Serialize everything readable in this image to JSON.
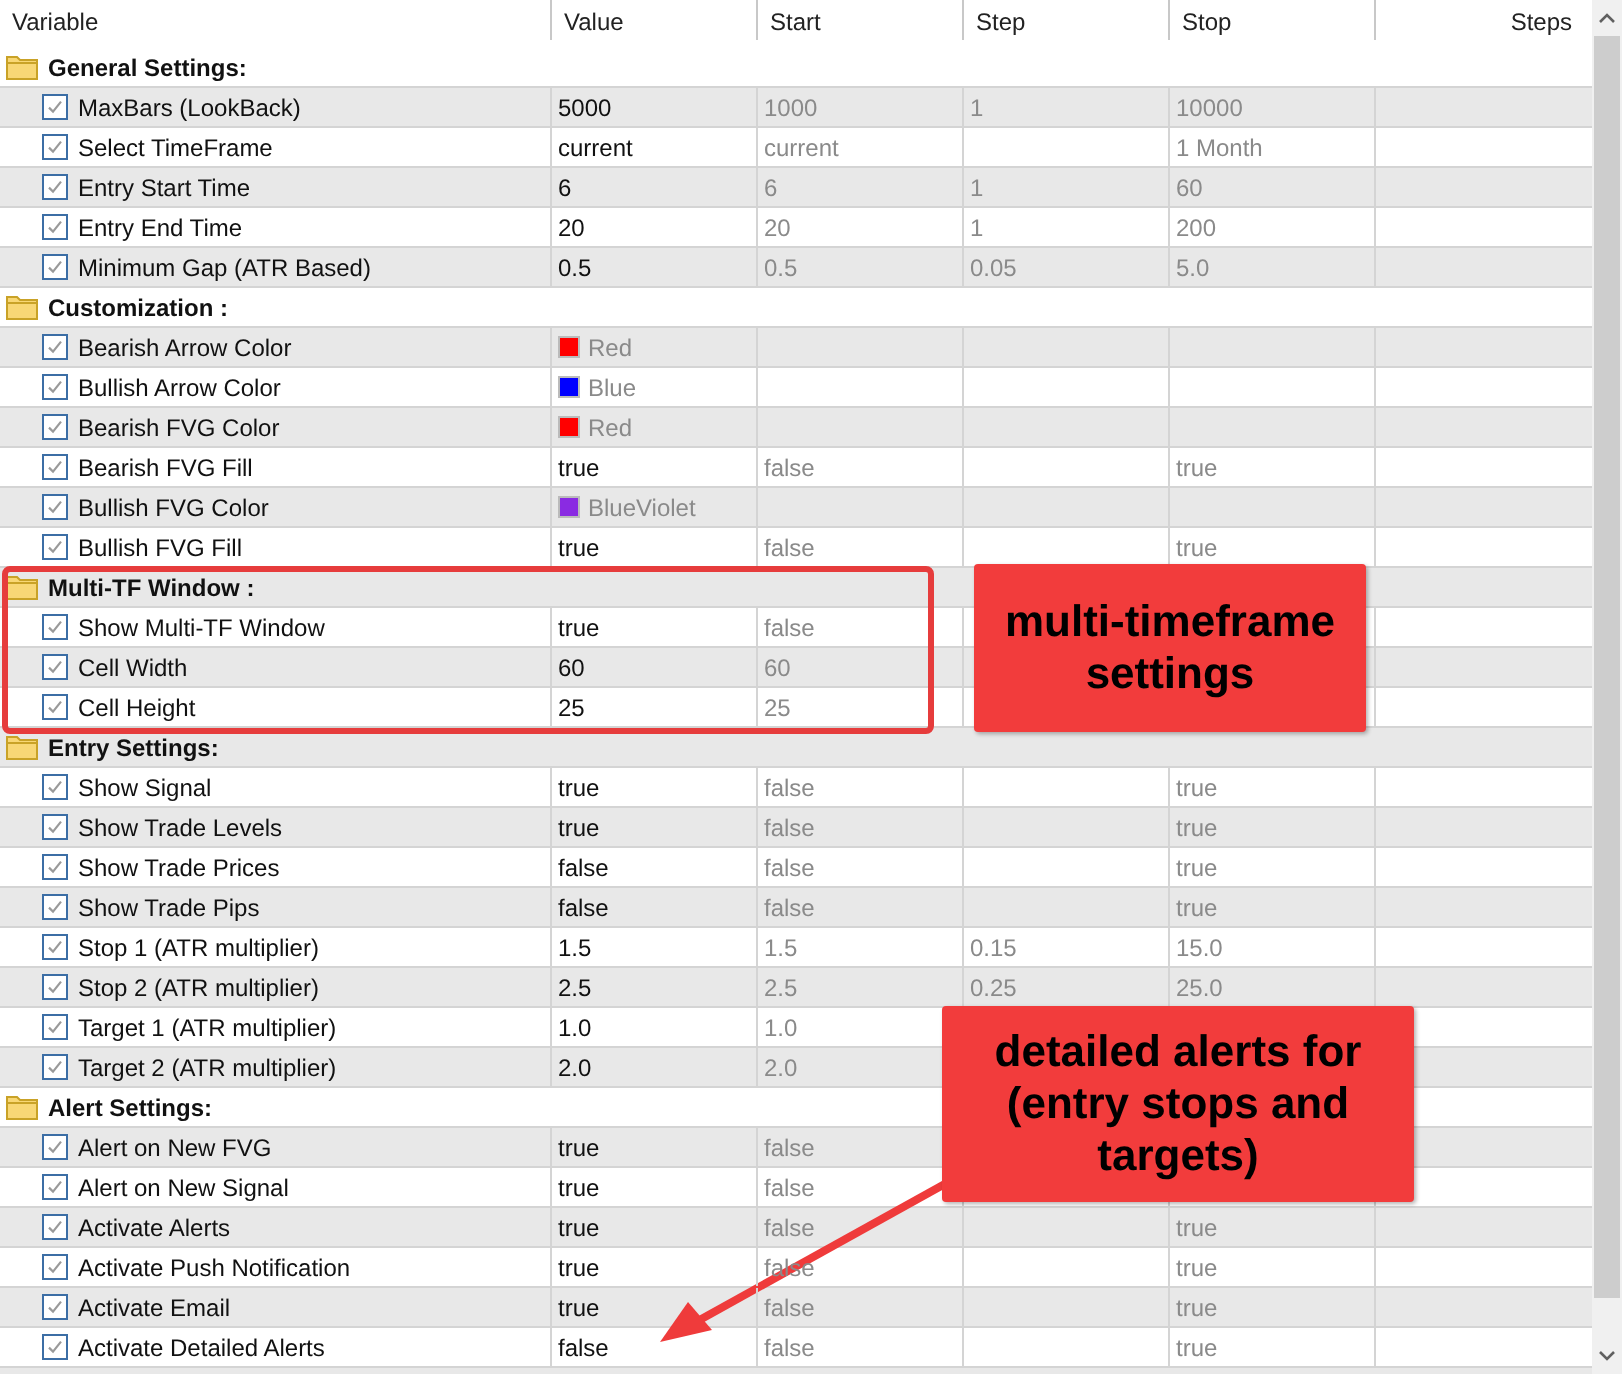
{
  "columns": [
    {
      "label": "Variable"
    },
    {
      "label": "Value"
    },
    {
      "label": "Start"
    },
    {
      "label": "Step"
    },
    {
      "label": "Stop"
    },
    {
      "label": "Steps"
    }
  ],
  "groups": [
    {
      "title": "General Settings:",
      "params": [
        {
          "name": "MaxBars (LookBack)",
          "checked": true,
          "kind": "plain",
          "value": "5000",
          "start": "1000",
          "step": "1",
          "stop": "10000"
        },
        {
          "name": "Select TimeFrame",
          "checked": true,
          "kind": "plain",
          "value": "current",
          "start": "current",
          "stop": "1 Month"
        },
        {
          "name": "Entry Start Time",
          "checked": true,
          "kind": "plain",
          "value": "6",
          "start": "6",
          "step": "1",
          "stop": "60"
        },
        {
          "name": "Entry End Time",
          "checked": true,
          "kind": "plain",
          "value": "20",
          "start": "20",
          "step": "1",
          "stop": "200"
        },
        {
          "name": "Minimum Gap (ATR Based)",
          "checked": true,
          "kind": "plain",
          "value": "0.5",
          "start": "0.5",
          "step": "0.05",
          "stop": "5.0"
        }
      ]
    },
    {
      "title": "Customization :",
      "params": [
        {
          "name": "Bearish Arrow Color",
          "checked": true,
          "kind": "color",
          "value": "Red",
          "color": "#ff0000"
        },
        {
          "name": "Bullish Arrow Color",
          "checked": true,
          "kind": "color",
          "value": "Blue",
          "color": "#0000ff"
        },
        {
          "name": "Bearish FVG Color",
          "checked": true,
          "kind": "color",
          "value": "Red",
          "color": "#ff0000"
        },
        {
          "name": "Bearish FVG Fill",
          "checked": true,
          "kind": "plain",
          "value": "true",
          "start": "false",
          "stop": "true"
        },
        {
          "name": "Bullish FVG Color",
          "checked": true,
          "kind": "color",
          "value": "BlueViolet",
          "color": "#8a2be2"
        },
        {
          "name": "Bullish FVG Fill",
          "checked": true,
          "kind": "plain",
          "value": "true",
          "start": "false",
          "stop": "true"
        }
      ]
    },
    {
      "title": "Multi-TF Window :",
      "params": [
        {
          "name": "Show Multi-TF Window",
          "checked": true,
          "kind": "plain",
          "value": "true",
          "start": "false"
        },
        {
          "name": "Cell Width",
          "checked": true,
          "kind": "plain",
          "value": "60",
          "start": "60"
        },
        {
          "name": "Cell Height",
          "checked": true,
          "kind": "plain",
          "value": "25",
          "start": "25"
        }
      ]
    },
    {
      "title": "Entry Settings:",
      "params": [
        {
          "name": "Show Signal",
          "checked": true,
          "kind": "plain",
          "value": "true",
          "start": "false",
          "stop": "true"
        },
        {
          "name": "Show Trade Levels",
          "checked": true,
          "kind": "plain",
          "value": "true",
          "start": "false",
          "stop": "true"
        },
        {
          "name": "Show Trade Prices",
          "checked": true,
          "kind": "plain",
          "value": "false",
          "start": "false",
          "stop": "true"
        },
        {
          "name": "Show Trade Pips",
          "checked": true,
          "kind": "plain",
          "value": "false",
          "start": "false",
          "stop": "true"
        },
        {
          "name": "Stop 1 (ATR multiplier)",
          "checked": true,
          "kind": "plain",
          "value": "1.5",
          "start": "1.5",
          "step": "0.15",
          "stop": "15.0"
        },
        {
          "name": "Stop 2 (ATR multiplier)",
          "checked": true,
          "kind": "plain",
          "value": "2.5",
          "start": "2.5",
          "step": "0.25",
          "stop": "25.0"
        },
        {
          "name": "Target 1 (ATR multiplier)",
          "checked": true,
          "kind": "plain",
          "value": "1.0",
          "start": "1.0"
        },
        {
          "name": "Target 2 (ATR multiplier)",
          "checked": true,
          "kind": "plain",
          "value": "2.0",
          "start": "2.0"
        }
      ]
    },
    {
      "title": "Alert Settings:",
      "params": [
        {
          "name": "Alert on New FVG",
          "checked": true,
          "kind": "plain",
          "value": "true",
          "start": "false"
        },
        {
          "name": "Alert on New Signal",
          "checked": true,
          "kind": "plain",
          "value": "true",
          "start": "false"
        },
        {
          "name": "Activate Alerts",
          "checked": true,
          "kind": "plain",
          "value": "true",
          "start": "false",
          "stop": "true"
        },
        {
          "name": "Activate Push Notification",
          "checked": true,
          "kind": "plain",
          "value": "true",
          "start": "false",
          "stop": "true"
        },
        {
          "name": "Activate Email",
          "checked": true,
          "kind": "plain",
          "value": "true",
          "start": "false",
          "stop": "true"
        },
        {
          "name": "Activate Detailed Alerts",
          "checked": true,
          "kind": "plain",
          "value": "false",
          "start": "false",
          "stop": "true"
        }
      ]
    }
  ],
  "annotations": [
    {
      "text": "multi-timeframe settings"
    },
    {
      "text": "detailed alerts for (entry stops and targets)"
    }
  ]
}
